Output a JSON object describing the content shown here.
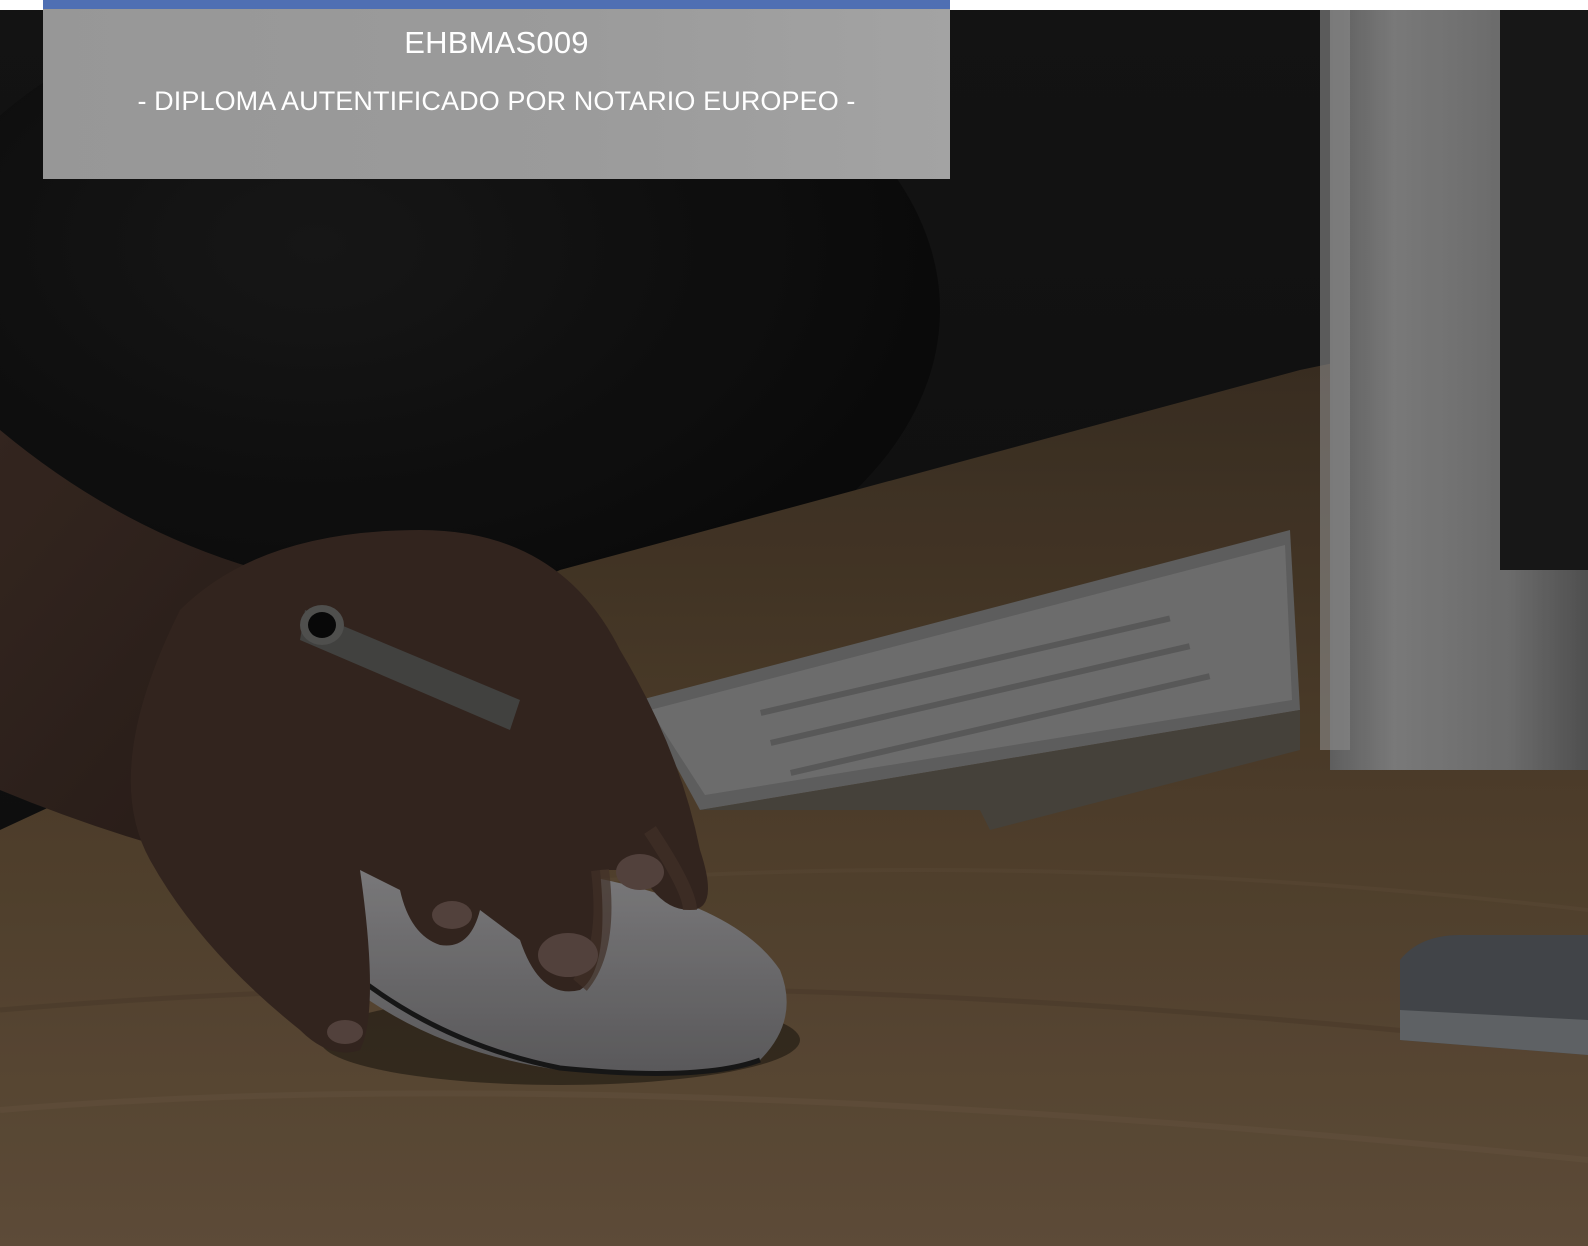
{
  "header": {
    "code": "EHBMAS009",
    "subtitle": "- DIPLOMA AUTENTIFICADO POR NOTARIO EUROPEO -"
  },
  "colors": {
    "accent": "#4f6fb3",
    "title_box": "#9a9a9a",
    "background_dark": "#141414",
    "desk_wood": "#5a4733"
  },
  "photo": {
    "icon": "hand-on-mouse-desk-photo"
  }
}
